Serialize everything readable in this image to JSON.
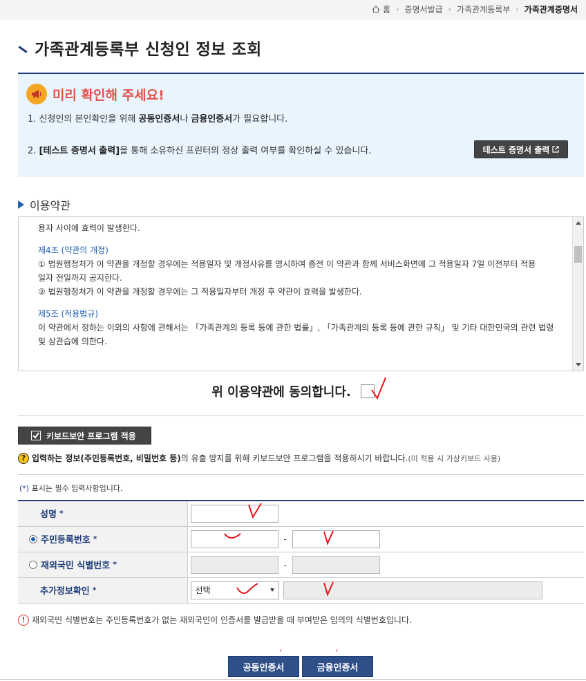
{
  "breadcrumb": [
    "홈",
    "증명서발급",
    "가족관계등록부",
    "가족관계증명서"
  ],
  "page_title": "가족관계등록부 신청인 정보 조회",
  "notice": {
    "title": "미리 확인해 주세요!",
    "line1_pre": "1. 신청인의 본인확인을 위해 ",
    "line1_b1": "공동인증서",
    "line1_mid": "나 ",
    "line1_b2": "금융인증서",
    "line1_post": "가 필요합니다.",
    "line2_pre": "2. ",
    "line2_b": "[테스트 증명서 출력]",
    "line2_post": "을 통해 소유하신 프린터의 정상 출력 여부를 확인하실 수 있습니다.",
    "test_button": "테스트 증명서 출력"
  },
  "terms": {
    "heading": "이용약관",
    "line0": "용자 사이에 효력이 발생한다.",
    "art4_title": "제4조 (약관의 개정)",
    "art4_l1": "① 법원행정처가 이 약관을 개정할 경우에는 적용일자 및 개정사유를 명시하여 종전 이 약관과 함께 서비스화면에 그 적용일자 7일 이전부터 적용",
    "art4_l2": "일자 전일까지 공지한다.",
    "art4_l3": "② 법원행정처가 이 약관을 개정할 경우에는 그 적용일자부터 개정 후 약관이 효력을 발생한다.",
    "art5_title": "제5조 (적용법규)",
    "art5_l1": "이 약관에서 정하는 이외의 사항에 관해서는 「가족관계의 등록 등에 관한 법률」, 「가족관계의 등록 등에 관한 규칙」 및 기타 대한민국의 관련 법령",
    "art5_l2": "및 상관습에 의한다.",
    "agree_label": "위 이용약관에 동의합니다."
  },
  "keyboard": {
    "button": "키보드보안 프로그램 적용",
    "note_b": "입력하는 정보",
    "note_b2": "(주민등록번호, 비밀번호 등)",
    "note_post": "의 유출 방지를 위해 키보드보안 프로그램을 적용하시기 바랍니다.",
    "note_muted": " (미 적용 시 가상키보드 사용)"
  },
  "required_note_star": "(*)",
  "required_note": " 표시는 필수 입력사항입니다.",
  "form": {
    "name_label": "성명",
    "rrn_label": "주민등록번호",
    "foreign_label": "재외국민 식별번호",
    "extra_label": "추가정보확인",
    "star": "*",
    "dash": "-",
    "select_value": "선택"
  },
  "foreign_note": "재외국민 식별번호는 주민등록번호가 없는 재외국민이 인증서를 발급받을 때 부여받은 임의의 식별번호입니다.",
  "buttons": {
    "public_cert": "공동인증서",
    "financial_cert": "금융인증서"
  },
  "colors": {
    "primary": "#1f3d7a",
    "notice_bg": "#eaf4fc",
    "alert": "#e0524a",
    "annotation": "#e8141b"
  }
}
